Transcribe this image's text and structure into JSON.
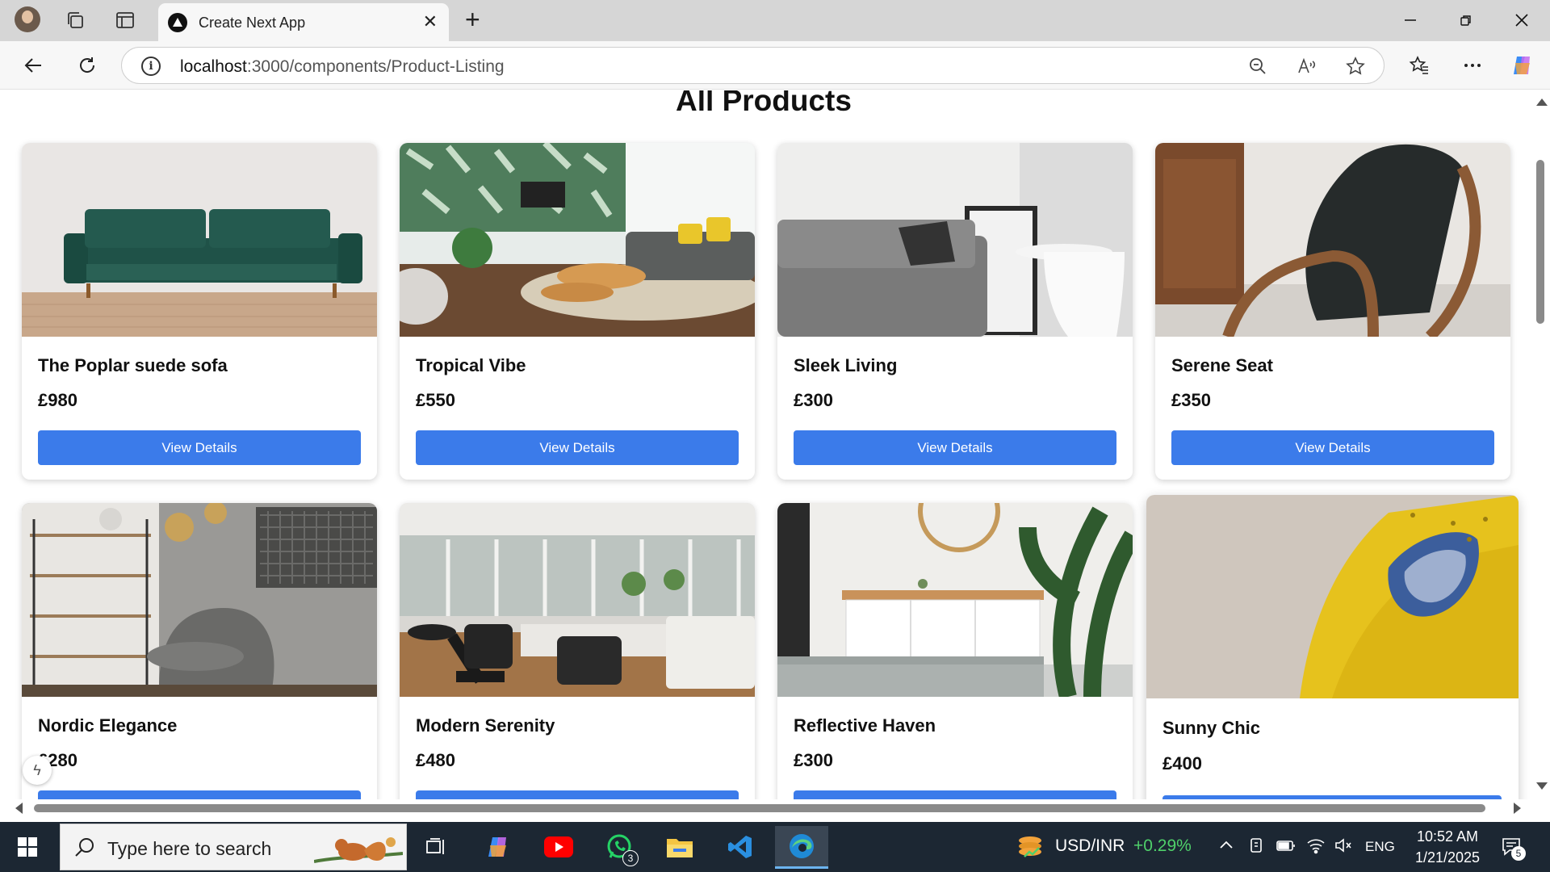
{
  "browser": {
    "tab_title": "Create Next App",
    "url_host": "localhost",
    "url_path": ":3000/components/Product-Listing"
  },
  "page": {
    "title": "All Products",
    "button_label": "View Details",
    "products": [
      {
        "name": "The Poplar suede sofa",
        "price": "£980"
      },
      {
        "name": "Tropical Vibe",
        "price": "£550"
      },
      {
        "name": "Sleek Living",
        "price": "£300"
      },
      {
        "name": "Serene Seat",
        "price": "£350"
      },
      {
        "name": "Nordic Elegance",
        "price": "£280"
      },
      {
        "name": "Modern Serenity",
        "price": "£480"
      },
      {
        "name": "Reflective Haven",
        "price": "£300"
      },
      {
        "name": "Sunny Chic",
        "price": "£400"
      }
    ]
  },
  "taskbar": {
    "search_placeholder": "Type here to search",
    "whatsapp_badge": "3",
    "ticker_label": "USD/INR",
    "ticker_change": "+0.29%",
    "language": "ENG",
    "time": "10:52 AM",
    "date": "1/21/2025",
    "notification_count": "5"
  },
  "colors": {
    "accent_button": "#3b7bea",
    "ticker_positive": "#4fd06a"
  }
}
